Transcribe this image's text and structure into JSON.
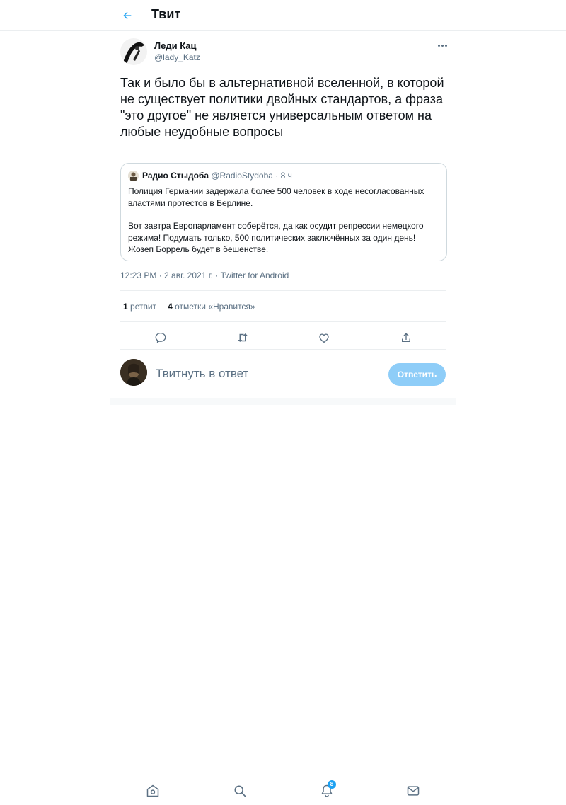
{
  "header": {
    "title": "Твит"
  },
  "tweet": {
    "author_name": "Леди Кац",
    "author_handle": "@lady_Katz",
    "text": "Так и было бы в альтернативной вселенной, в которой не существует политики двойных стандартов, а фраза \"это другое\" не является универсальным ответом на любые неудобные вопросы",
    "quote": {
      "name": "Радио Стыдоба",
      "handle": "@RadioStydoba",
      "time": "· 8 ч",
      "paragraph1": "Полиция Германии задержала более 500 человек в ходе несогласованных властями протестов в Берлине.",
      "paragraph2": "Вот завтра Европарламент соберётся, да как осудит репрессии немецкого режима! Подумать только, 500 политических заключённых за один день! Жозеп Боррель будет в бешенстве."
    },
    "timestamp": "12:23 PM · 2 авг. 2021 г. · Twitter for Android",
    "stats": {
      "retweets_count": "1",
      "retweets_label": "ретвит",
      "likes_count": "4",
      "likes_label": "отметки «Нравится»"
    }
  },
  "reply": {
    "placeholder": "Твитнуть в ответ",
    "button_label": "Ответить"
  },
  "bottom_nav": {
    "items": [
      "home-icon",
      "search-icon",
      "notifications-icon",
      "messages-icon"
    ],
    "notifications_badge": "8"
  },
  "colors": {
    "accent": "#1da1f2",
    "reply_button": "#8ecdf8",
    "secondary_text": "#5b7083"
  }
}
